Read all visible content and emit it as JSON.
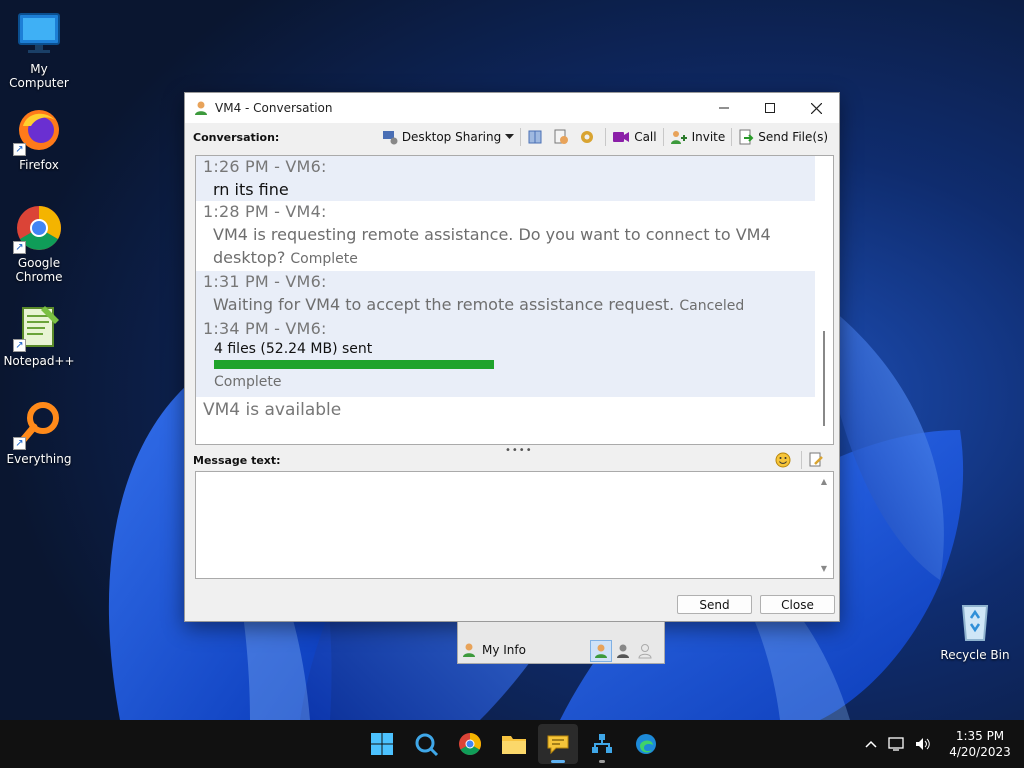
{
  "desktop": {
    "icons": [
      {
        "label": "My Computer"
      },
      {
        "label": "Firefox"
      },
      {
        "label": "Google Chrome"
      },
      {
        "label": "Notepad++"
      },
      {
        "label": "Everything"
      },
      {
        "label": "Recycle Bin"
      }
    ]
  },
  "window": {
    "title": "VM4 - Conversation",
    "conversation_label": "Conversation:",
    "toolbar": {
      "desktop_sharing": "Desktop Sharing",
      "call": "Call",
      "invite": "Invite",
      "send_files": "Send File(s)"
    },
    "log": [
      {
        "header": "1:26 PM - VM6:",
        "message": "rn its fine"
      },
      {
        "header": "1:28 PM - VM4:",
        "message": "VM4 is requesting remote assistance. Do you want to connect to VM4 desktop?",
        "status": "Complete"
      },
      {
        "header": "1:31 PM - VM6:",
        "message": "Waiting for VM4 to accept the remote assistance request.",
        "status": "Canceled"
      },
      {
        "header": "1:34 PM - VM6:",
        "file_text": "4 files (52.24 MB) sent",
        "progress": 1.0,
        "status": "Complete"
      }
    ],
    "availability": "VM4 is available",
    "message_label": "Message text:",
    "message_value": "",
    "send_label": "Send",
    "close_label": "Close"
  },
  "main_strip": {
    "my_info": "My Info"
  },
  "taskbar": {
    "time": "1:35 PM",
    "date": "4/20/2023"
  },
  "colors": {
    "progress": "#1fa32b",
    "shaded_row": "#e9eef8",
    "taskbar": "#111111"
  }
}
